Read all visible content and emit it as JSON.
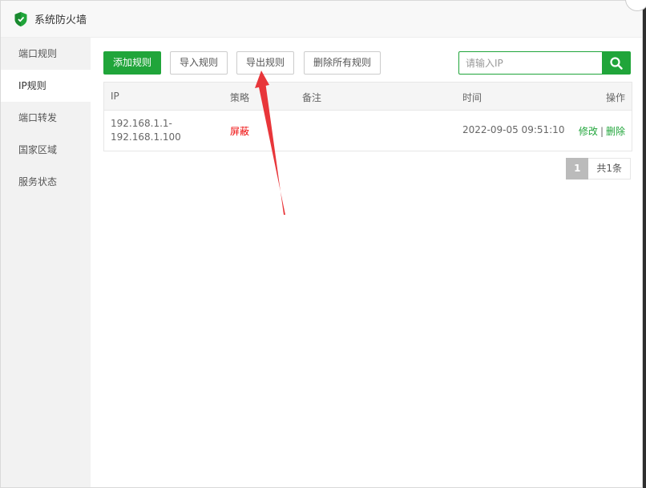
{
  "window": {
    "title": "系统防火墙"
  },
  "sidebar": {
    "items": [
      {
        "label": "端口规则",
        "active": false
      },
      {
        "label": "IP规则",
        "active": true
      },
      {
        "label": "端口转发",
        "active": false
      },
      {
        "label": "国家区域",
        "active": false
      },
      {
        "label": "服务状态",
        "active": false
      }
    ]
  },
  "toolbar": {
    "add_label": "添加规则",
    "import_label": "导入规则",
    "export_label": "导出规则",
    "delete_all_label": "删除所有规则"
  },
  "search": {
    "placeholder": "请输入IP",
    "value": ""
  },
  "table": {
    "headers": {
      "ip": "IP",
      "policy": "策略",
      "remark": "备注",
      "time": "时间",
      "operation": "操作"
    },
    "rows": [
      {
        "ip_start": "192.168.1.1-",
        "ip_end": "192.168.1.100",
        "policy": "屏蔽",
        "remark": "",
        "time": "2022-09-05 09:51:10",
        "edit": "修改",
        "separator": "|",
        "delete": "删除"
      }
    ]
  },
  "pagination": {
    "current": "1",
    "total_text": "共1条"
  },
  "colors": {
    "accent": "#20a53a",
    "danger": "#ef0808",
    "annotation_arrow": "#e8363a"
  }
}
